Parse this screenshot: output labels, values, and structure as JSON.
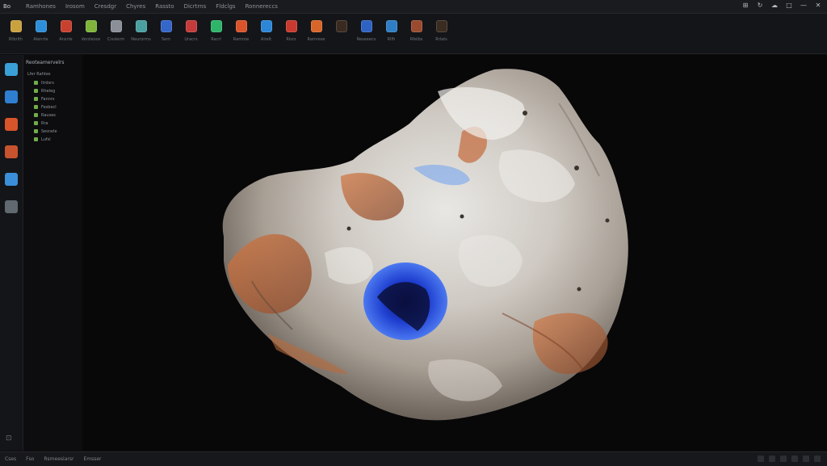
{
  "menubar": {
    "logo": "Bo",
    "items": [
      "Ramhones",
      "Irosom",
      "Cresdgr",
      "Chyres",
      "Rassto",
      "Dicrtrns",
      "Fldclgs",
      "Ronnereccs"
    ]
  },
  "window_controls": [
    "⊞",
    "↻",
    "☁",
    "□",
    "—",
    "✕"
  ],
  "toolbar": {
    "tools": [
      {
        "label": "Rtbrlth",
        "color": "#c9a23f",
        "icon": "sphere-icon"
      },
      {
        "label": "Alenrte",
        "color": "#2e8fd8",
        "icon": "cube-icon"
      },
      {
        "label": "Ansrte",
        "color": "#c8412f",
        "icon": "material-icon"
      },
      {
        "label": "Verzleoos",
        "color": "#7fb53b",
        "icon": "paint-icon"
      },
      {
        "label": "Cisslerm",
        "color": "#8a8f98",
        "icon": "gear-icon"
      },
      {
        "label": "Neurorms",
        "color": "#4aa0a0",
        "icon": "layer-icon"
      },
      {
        "label": "Sem",
        "color": "#3566c9",
        "icon": "node-icon"
      },
      {
        "label": "Uracrs",
        "color": "#c43b3b",
        "icon": "texture-icon"
      },
      {
        "label": "Racrl",
        "color": "#2fb56a",
        "icon": "green-icon"
      },
      {
        "label": "Ramroe",
        "color": "#d9542b",
        "icon": "orange-icon"
      },
      {
        "label": "Alrelt",
        "color": "#2d86d6",
        "icon": "blue-cube-icon"
      },
      {
        "label": "Rlsrs",
        "color": "#c83a2f",
        "icon": "red-cube-icon"
      },
      {
        "label": "Ramrese",
        "color": "#d8662a",
        "icon": "brick-icon"
      },
      {
        "label": "",
        "color": "#3a2a20",
        "icon": "dim-icon"
      },
      {
        "label": "Reseeecs",
        "color": "#2f63c3",
        "icon": "blue-icon"
      },
      {
        "label": "Rlfh",
        "color": "#2f7ec5",
        "icon": "sky-icon"
      },
      {
        "label": "Rfelbs",
        "color": "#9a4b2f",
        "icon": "brown-icon"
      },
      {
        "label": "Rrlats",
        "color": "#3a2c20",
        "icon": "dark-icon"
      }
    ]
  },
  "left_rail": {
    "buttons": [
      {
        "icon": "select-icon",
        "color": "#3ba0d8"
      },
      {
        "icon": "move-icon",
        "color": "#2f7fd0"
      },
      {
        "icon": "sculpt-icon",
        "color": "#d8542a"
      },
      {
        "icon": "paint-brush-icon",
        "color": "#c8542f"
      },
      {
        "icon": "globe-icon",
        "color": "#3a8fd8"
      },
      {
        "icon": "grid-icon",
        "color": "#606870"
      }
    ],
    "bottom": "⊡"
  },
  "outliner": {
    "title": "Reoteamervelrs",
    "root": "Lfer Rahtes",
    "items": [
      "Itrdsrs",
      "Rheleg",
      "Fannrs",
      "Fesbecl",
      "Rauses",
      "Rra",
      "Sesnele",
      "Lufsl"
    ]
  },
  "statusbar": {
    "items": [
      "Cses",
      "Fso",
      "Rsmeesiarsr",
      "Emsser"
    ]
  }
}
